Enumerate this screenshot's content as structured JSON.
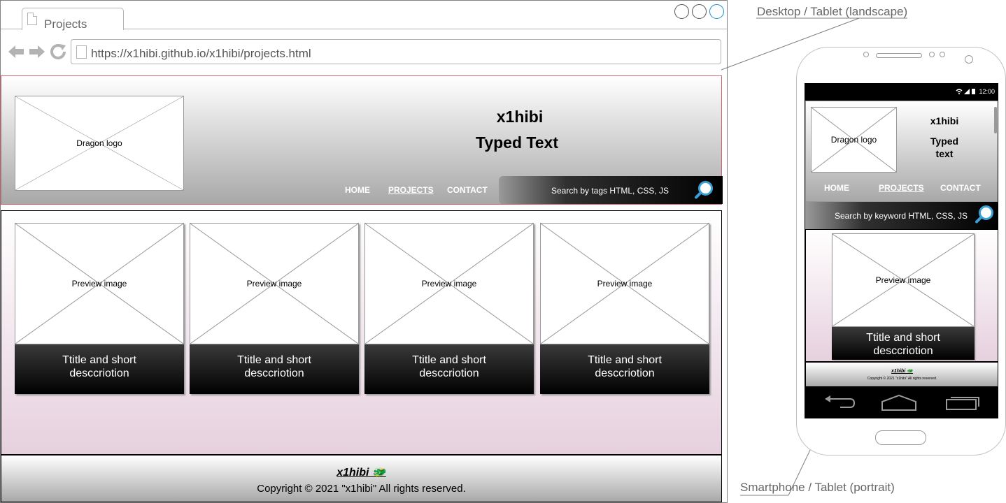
{
  "browser": {
    "tab_title": "Projects",
    "url": "https://x1hibi.github.io/x1hibi/projects.html",
    "back_icon": "back-arrow-icon",
    "forward_icon": "forward-arrow-icon",
    "reload_icon": "reload-icon"
  },
  "desktop": {
    "logo_label": "Dragon logo",
    "site_name": "x1hibi",
    "typed_text": "Typed Text",
    "nav": {
      "home": "HOME",
      "projects": "PROJECTS",
      "contact": "CONTACT"
    },
    "search_placeholder": "Search by tags HTML, CSS, JS",
    "cards": [
      {
        "image_label": "Preview image",
        "caption_line1": "Ttitle and short",
        "caption_line2": "desccriotion"
      },
      {
        "image_label": "Preview image",
        "caption_line1": "Ttitle and short",
        "caption_line2": "desccriotion"
      },
      {
        "image_label": "Preview image",
        "caption_line1": "Ttitle and short",
        "caption_line2": "desccriotion"
      },
      {
        "image_label": "Preview image",
        "caption_line1": "Ttitle and short",
        "caption_line2": "desccriotion"
      }
    ],
    "footer_brand": "x1hibi 🐲",
    "footer_copyright": "Copyright © 2021 \"x1hibi\"  All rights reserved."
  },
  "annotations": {
    "desktop_label": "Desktop / Tablet (landscape)",
    "mobile_label": "Smartphone / Tablet (portrait)"
  },
  "mobile": {
    "status_time": "12:00",
    "logo_label": "Dragon logo",
    "site_name": "x1hibi",
    "typed_text_line1": "Typed",
    "typed_text_line2": "text",
    "nav": {
      "home": "HOME",
      "projects": "PROJECTS",
      "contact": "CONTACT"
    },
    "search_placeholder": "Search by keyword HTML, CSS, JS",
    "card": {
      "image_label": "Preview image",
      "caption_line1": "Ttitle and short",
      "caption_line2": "desccriotion"
    },
    "footer_brand": "x1hibi 🐲",
    "footer_copyright": "Copyright © 2021 \"x1hibi\"  All rights reserved."
  },
  "colors": {
    "accent": "#3aa0d8",
    "header_border": "#cc6677",
    "main_gradient_end": "#e6d0de"
  }
}
